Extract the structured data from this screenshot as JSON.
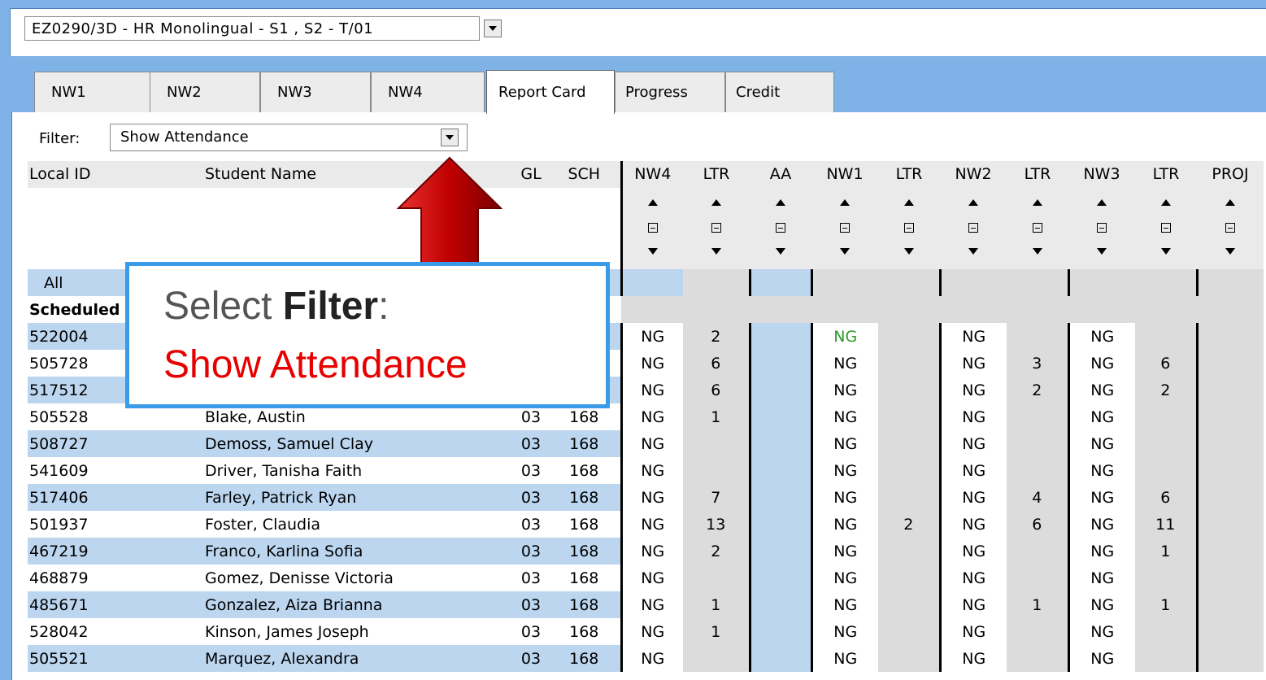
{
  "section_selector": {
    "value": "EZ0290/3D - HR Monolingual - S1 , S2 - T/01"
  },
  "tabs": [
    {
      "label": "NW1"
    },
    {
      "label": "NW2"
    },
    {
      "label": "NW3"
    },
    {
      "label": "NW4"
    },
    {
      "label": "Report Card"
    },
    {
      "label": "Progress"
    },
    {
      "label": "Credit"
    }
  ],
  "active_tab": "Report Card",
  "filter": {
    "label": "Filter:",
    "value": "Show Attendance"
  },
  "table": {
    "headers": [
      "Local ID",
      "Student Name",
      "GL",
      "SCH",
      "NW4",
      "LTR",
      "AA",
      "NW1",
      "LTR",
      "NW2",
      "LTR",
      "NW3",
      "LTR",
      "PROJ"
    ],
    "all_label": "All",
    "scheduled_label": "Scheduled",
    "rows": [
      {
        "id": "522004",
        "name": "",
        "gl": "",
        "sch": "",
        "nw4": "NG",
        "ltr1": "2",
        "nw1": "NG",
        "ltr2": "",
        "nw2": "NG",
        "ltr3": "",
        "nw3": "NG",
        "ltr4": "",
        "nw1_green": true
      },
      {
        "id": "505728",
        "name": "",
        "gl": "",
        "sch": "",
        "nw4": "NG",
        "ltr1": "6",
        "nw1": "NG",
        "ltr2": "",
        "nw2": "NG",
        "ltr3": "3",
        "nw3": "NG",
        "ltr4": "6"
      },
      {
        "id": "517512",
        "name": "",
        "gl": "",
        "sch": "",
        "nw4": "NG",
        "ltr1": "6",
        "nw1": "NG",
        "ltr2": "",
        "nw2": "NG",
        "ltr3": "2",
        "nw3": "NG",
        "ltr4": "2"
      },
      {
        "id": "505528",
        "name": "Blake, Austin",
        "gl": "03",
        "sch": "168",
        "nw4": "NG",
        "ltr1": "1",
        "nw1": "NG",
        "ltr2": "",
        "nw2": "NG",
        "ltr3": "",
        "nw3": "NG",
        "ltr4": ""
      },
      {
        "id": "508727",
        "name": "Demoss, Samuel Clay",
        "gl": "03",
        "sch": "168",
        "nw4": "NG",
        "ltr1": "",
        "nw1": "NG",
        "ltr2": "",
        "nw2": "NG",
        "ltr3": "",
        "nw3": "NG",
        "ltr4": ""
      },
      {
        "id": "541609",
        "name": "Driver, Tanisha Faith",
        "gl": "03",
        "sch": "168",
        "nw4": "NG",
        "ltr1": "",
        "nw1": "NG",
        "ltr2": "",
        "nw2": "NG",
        "ltr3": "",
        "nw3": "NG",
        "ltr4": ""
      },
      {
        "id": "517406",
        "name": "Farley, Patrick Ryan",
        "gl": "03",
        "sch": "168",
        "nw4": "NG",
        "ltr1": "7",
        "nw1": "NG",
        "ltr2": "",
        "nw2": "NG",
        "ltr3": "4",
        "nw3": "NG",
        "ltr4": "6"
      },
      {
        "id": "501937",
        "name": "Foster, Claudia",
        "gl": "03",
        "sch": "168",
        "nw4": "NG",
        "ltr1": "13",
        "nw1": "NG",
        "ltr2": "2",
        "nw2": "NG",
        "ltr3": "6",
        "nw3": "NG",
        "ltr4": "11"
      },
      {
        "id": "467219",
        "name": "Franco, Karlina Sofia",
        "gl": "03",
        "sch": "168",
        "nw4": "NG",
        "ltr1": "2",
        "nw1": "NG",
        "ltr2": "",
        "nw2": "NG",
        "ltr3": "",
        "nw3": "NG",
        "ltr4": "1"
      },
      {
        "id": "468879",
        "name": "Gomez, Denisse Victoria",
        "gl": "03",
        "sch": "168",
        "nw4": "NG",
        "ltr1": "",
        "nw1": "NG",
        "ltr2": "",
        "nw2": "NG",
        "ltr3": "",
        "nw3": "NG",
        "ltr4": ""
      },
      {
        "id": "485671",
        "name": "Gonzalez, Aiza Brianna",
        "gl": "03",
        "sch": "168",
        "nw4": "NG",
        "ltr1": "1",
        "nw1": "NG",
        "ltr2": "",
        "nw2": "NG",
        "ltr3": "1",
        "nw3": "NG",
        "ltr4": "1"
      },
      {
        "id": "528042",
        "name": "Kinson, James Joseph",
        "gl": "03",
        "sch": "168",
        "nw4": "NG",
        "ltr1": "1",
        "nw1": "NG",
        "ltr2": "",
        "nw2": "NG",
        "ltr3": "",
        "nw3": "NG",
        "ltr4": ""
      },
      {
        "id": "505521",
        "name": "Marquez, Alexandra",
        "gl": "03",
        "sch": "168",
        "nw4": "NG",
        "ltr1": "",
        "nw1": "NG",
        "ltr2": "",
        "nw2": "NG",
        "ltr3": "",
        "nw3": "NG",
        "ltr4": ""
      }
    ]
  },
  "callout": {
    "prefix": "Select ",
    "bold": "Filter",
    "suffix": ":",
    "line2": "Show Attendance"
  },
  "colors": {
    "accent_blue": "#3a9be8",
    "callout_red": "#e60000",
    "arrow_red": "#c00000",
    "ng_green": "#2a9a2a"
  }
}
